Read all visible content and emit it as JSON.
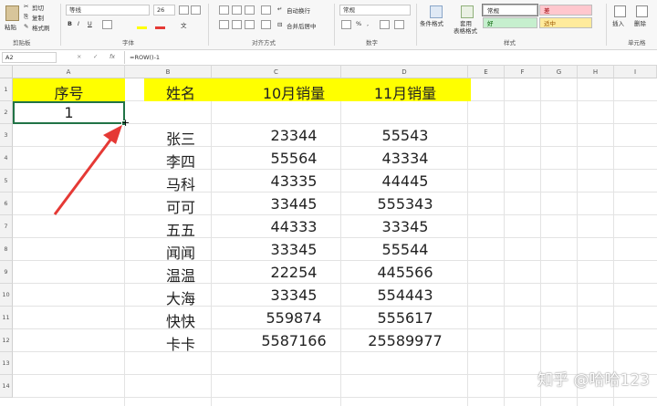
{
  "ribbon": {
    "clipboard": {
      "paste": "粘贴",
      "cut": "剪切",
      "copy": "复制",
      "format_painter": "格式刷",
      "group": "剪贴板"
    },
    "font": {
      "name": "等线",
      "size": "26",
      "bold": "B",
      "italic": "I",
      "underline": "U",
      "wen": "文",
      "group": "字体"
    },
    "alignment": {
      "wrap": "自动换行",
      "merge": "合并后居中",
      "group": "对齐方式"
    },
    "number": {
      "format": "常规",
      "percent": "%",
      "comma": ",",
      "group": "数字"
    },
    "styles": {
      "conditional": "条件格式",
      "table_fmt_1": "套用",
      "table_fmt_2": "表格格式",
      "normal": "常规",
      "bad": "差",
      "good": "好",
      "neutral": "适中",
      "group": "样式"
    },
    "cells": {
      "insert": "插入",
      "delete": "删除",
      "group": "单元格"
    }
  },
  "formula_bar": {
    "name_box": "A2",
    "cancel": "×",
    "enter": "✓",
    "fx": "fx",
    "formula": "=ROW()-1"
  },
  "columns": [
    "A",
    "B",
    "C",
    "D",
    "E",
    "F",
    "G",
    "H",
    "I"
  ],
  "rows": [
    "1",
    "2",
    "3",
    "4",
    "5",
    "6",
    "7",
    "8",
    "9",
    "10",
    "11",
    "12",
    "13",
    "14"
  ],
  "sheet": {
    "headers": {
      "seq": "序号",
      "name": "姓名",
      "oct": "10月销量",
      "nov": "11月销量"
    },
    "a2": "1",
    "records": [
      {
        "name": "张三",
        "oct": "23344",
        "nov": "55543"
      },
      {
        "name": "李四",
        "oct": "55564",
        "nov": "43334"
      },
      {
        "name": "马科",
        "oct": "43335",
        "nov": "44445"
      },
      {
        "name": "可可",
        "oct": "33445",
        "nov": "555343"
      },
      {
        "name": "五五",
        "oct": "44333",
        "nov": "33345"
      },
      {
        "name": "闻闻",
        "oct": "33345",
        "nov": "55544"
      },
      {
        "name": "温温",
        "oct": "22254",
        "nov": "445566"
      },
      {
        "name": "大海",
        "oct": "33345",
        "nov": "554443"
      },
      {
        "name": "快快",
        "oct": "559874",
        "nov": "555617"
      },
      {
        "name": "卡卡",
        "oct": "5587166",
        "nov": "25589977"
      }
    ]
  },
  "colors": {
    "header_fill": "#ffff00",
    "selection": "#217346",
    "annotation_arrow": "#e53935"
  },
  "watermark": "知乎 @哈哈123"
}
